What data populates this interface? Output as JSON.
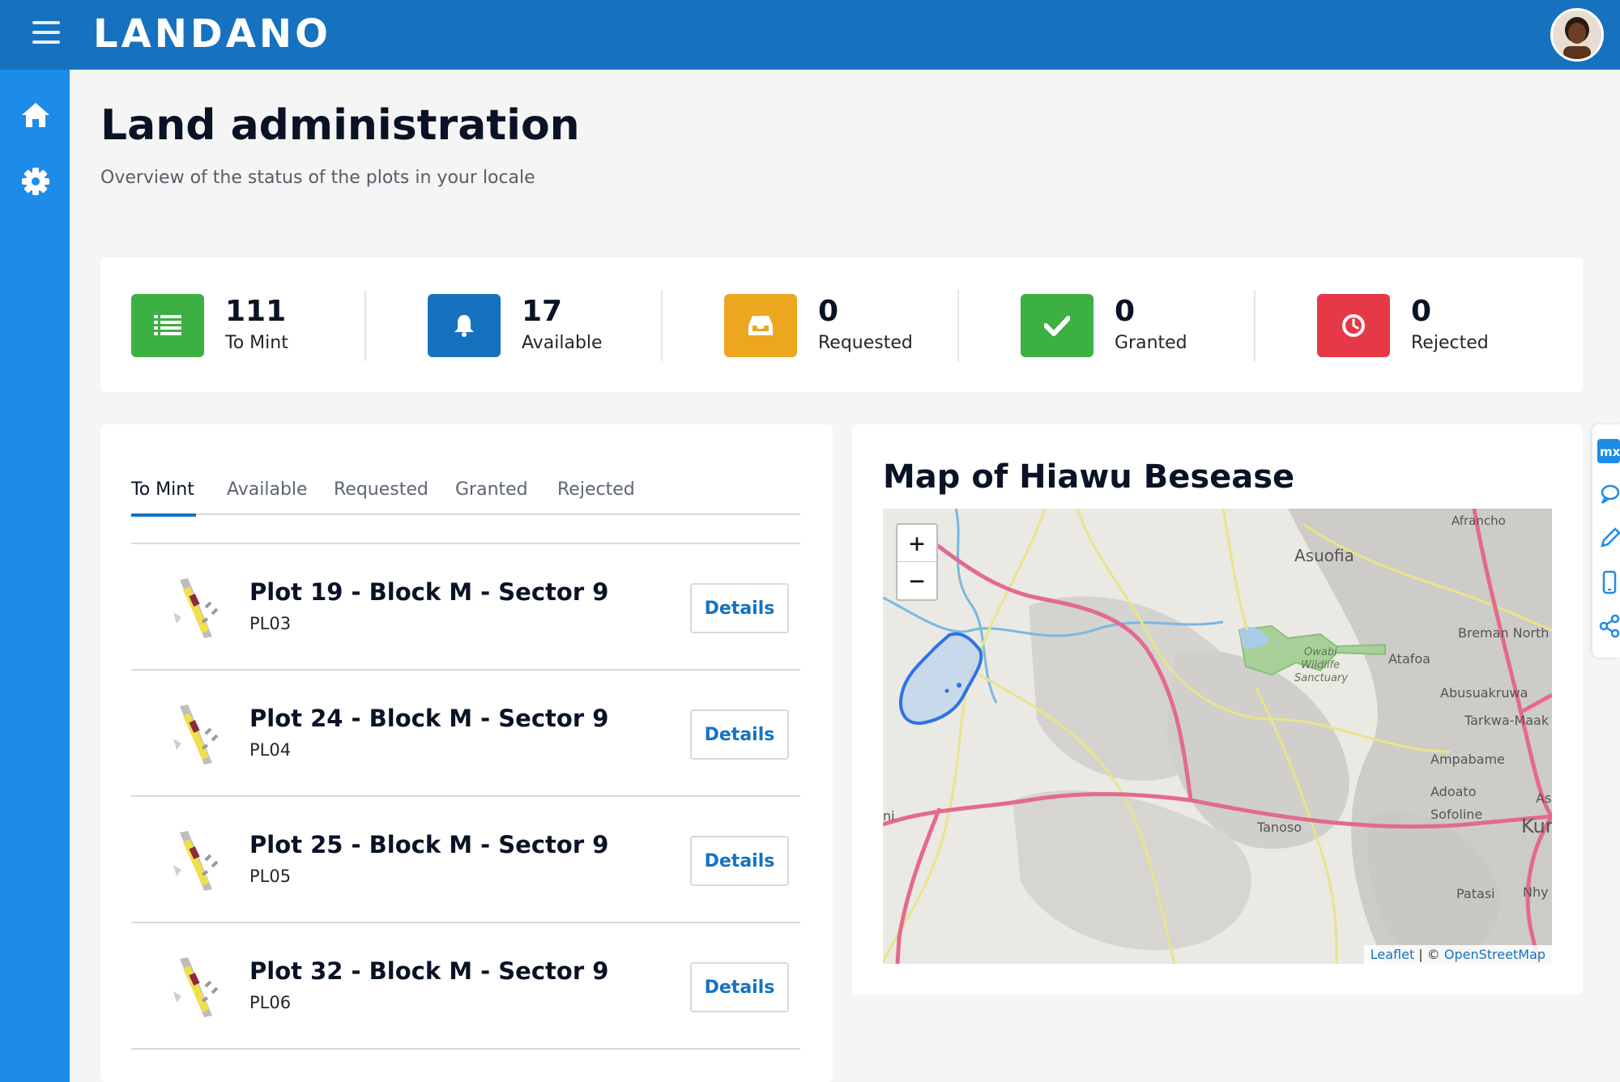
{
  "header": {
    "logo": "LANDANO"
  },
  "sidebar": {
    "items": [
      {
        "icon": "home-icon"
      },
      {
        "icon": "gear-icon"
      }
    ]
  },
  "page": {
    "title": "Land administration",
    "subtitle": "Overview of the status of the plots in your locale"
  },
  "stats": [
    {
      "value": "111",
      "label": "To Mint",
      "icon": "list-icon",
      "color": "#3cb043"
    },
    {
      "value": "17",
      "label": "Available",
      "icon": "bell-icon",
      "color": "#1672bf"
    },
    {
      "value": "0",
      "label": "Requested",
      "icon": "inbox-icon",
      "color": "#eda620"
    },
    {
      "value": "0",
      "label": "Granted",
      "icon": "check-icon",
      "color": "#3cb043"
    },
    {
      "value": "0",
      "label": "Rejected",
      "icon": "clock-icon",
      "color": "#e53948"
    }
  ],
  "tabs": [
    "To Mint",
    "Available",
    "Requested",
    "Granted",
    "Rejected"
  ],
  "active_tab": "To Mint",
  "plots": [
    {
      "title": "Plot 19 - Block M - Sector 9",
      "code": "PL03",
      "button": "Details"
    },
    {
      "title": "Plot 24 - Block M - Sector 9",
      "code": "PL04",
      "button": "Details"
    },
    {
      "title": "Plot 25 - Block M - Sector 9",
      "code": "PL05",
      "button": "Details"
    },
    {
      "title": "Plot 32 - Block M - Sector 9",
      "code": "PL06",
      "button": "Details"
    }
  ],
  "map": {
    "title": "Map of Hiawu Besease",
    "zoom_in": "+",
    "zoom_out": "−",
    "attribution_leaflet": "Leaflet",
    "attribution_sep": " | © ",
    "attribution_osm": "OpenStreetMap",
    "labels": {
      "afrancho": "Afrancho",
      "asuofia": "Asuofia",
      "breman": "Breman North",
      "owabi1": "Owabi",
      "owabi2": "Wildlife",
      "owabi3": "Sanctuary",
      "atafoa": "Atafoa",
      "abusuakruwa": "Abusuakruwa",
      "tarkwa": "Tarkwa-Maak",
      "ampabame": "Ampabame",
      "adoato": "Adoato",
      "sofoline": "Sofoline",
      "tanoso": "Tanoso",
      "kum": "Kur",
      "as": "As",
      "patasi": "Patasi",
      "nhy": "Nhy",
      "ni": "ni"
    }
  },
  "right_toolbar": [
    "mx-logo-icon",
    "chat-icon",
    "pencil-icon",
    "mobile-icon",
    "share-icon"
  ]
}
